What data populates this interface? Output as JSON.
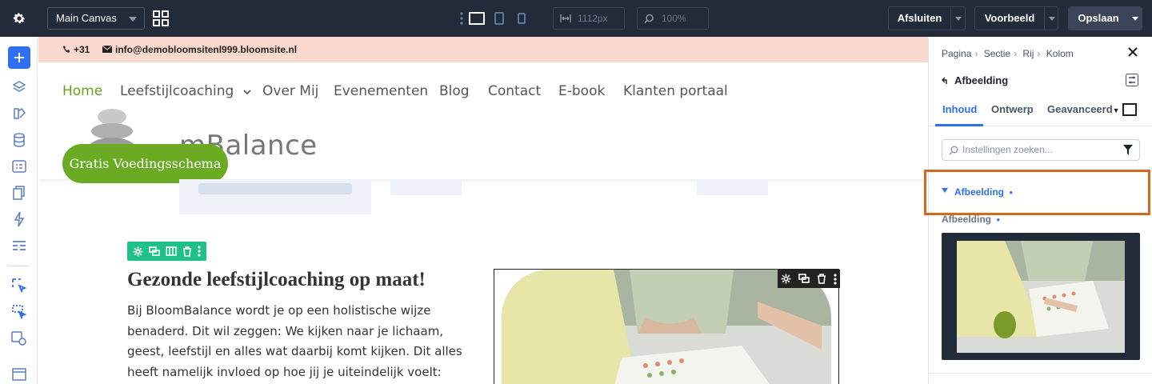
{
  "topbar": {
    "canvas_select": "Main Canvas",
    "width_value": "1112px",
    "zoom_value": "100%",
    "close_label": "Afsluiten",
    "preview_label": "Voorbeeld",
    "save_label": "Opslaan"
  },
  "site": {
    "contact_phone": "+31",
    "contact_email": "info@demobloomsitenl999.bloomsite.nl",
    "nav": [
      "Home",
      "Leefstijlcoaching",
      "Over Mij",
      "Evenementen",
      "Blog",
      "Contact",
      "E-book",
      "Klanten portaal"
    ],
    "logo_text": "mBalance",
    "cta_label": "Gratis Voedingsschema",
    "heading": "Gezonde leefstijlcoaching op maat!",
    "paragraph": "Bij BloomBalance wordt je op een holistische wijze benaderd. Dit wil zeggen: We kijken naar je lichaam, geest, leefstijl en alles wat daarbij komt kijken. Dit alles heeft namelijk invloed op hoe jij je uiteindelijk voelt: Zowel fysiek als mentaal."
  },
  "panel": {
    "breadcrumb": [
      "Pagina",
      "Sectie",
      "Rij",
      "Kolom"
    ],
    "element_title": "Afbeelding",
    "tabs": [
      "Inhoud",
      "Ontwerp",
      "Geavanceerd"
    ],
    "search_placeholder": "Instellingen zoeken...",
    "section_label": "Afbeelding",
    "field_label": "Afbeelding"
  },
  "colors": {
    "accent": "#2e6ff0",
    "brand_green": "#6aab23",
    "highlight": "#d2691e",
    "topbar": "#222b3a"
  }
}
